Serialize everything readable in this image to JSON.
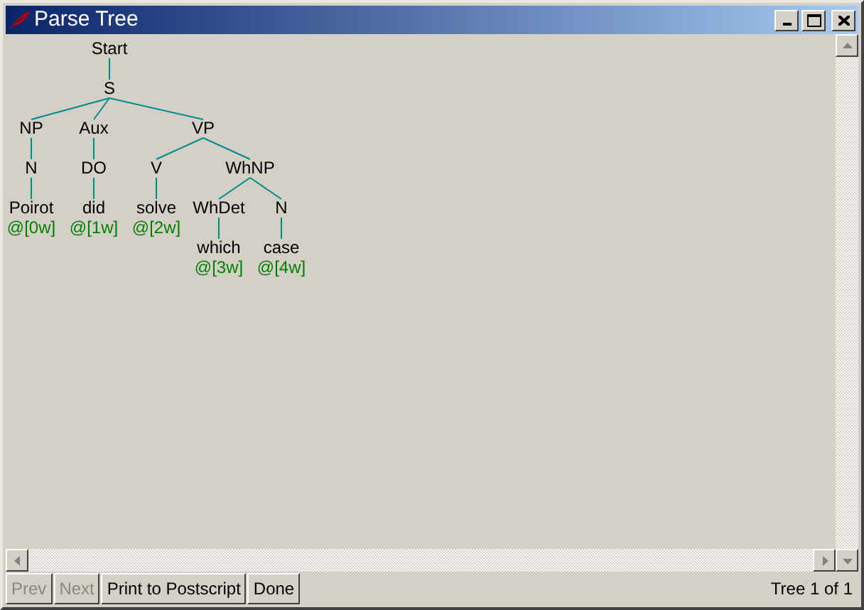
{
  "window": {
    "title": "Parse Tree"
  },
  "tree": {
    "label": "Start",
    "children": [
      {
        "label": "S",
        "children": [
          {
            "label": "NP",
            "children": [
              {
                "label": "N",
                "children": [
                  {
                    "label": "Poirot",
                    "index": "@[0w]"
                  }
                ]
              }
            ]
          },
          {
            "label": "Aux",
            "children": [
              {
                "label": "DO",
                "children": [
                  {
                    "label": "did",
                    "index": "@[1w]"
                  }
                ]
              }
            ]
          },
          {
            "label": "VP",
            "children": [
              {
                "label": "V",
                "children": [
                  {
                    "label": "solve",
                    "index": "@[2w]"
                  }
                ]
              },
              {
                "label": "WhNP",
                "children": [
                  {
                    "label": "WhDet",
                    "children": [
                      {
                        "label": "which",
                        "index": "@[3w]"
                      }
                    ]
                  },
                  {
                    "label": "N",
                    "children": [
                      {
                        "label": "case",
                        "index": "@[4w]"
                      }
                    ]
                  }
                ]
              }
            ]
          }
        ]
      }
    ]
  },
  "buttons": [
    {
      "label": "Prev",
      "disabled": true
    },
    {
      "label": "Next",
      "disabled": true
    },
    {
      "label": "Print to Postscript",
      "disabled": false
    },
    {
      "label": "Done",
      "disabled": false
    }
  ],
  "status": "Tree 1 of 1"
}
